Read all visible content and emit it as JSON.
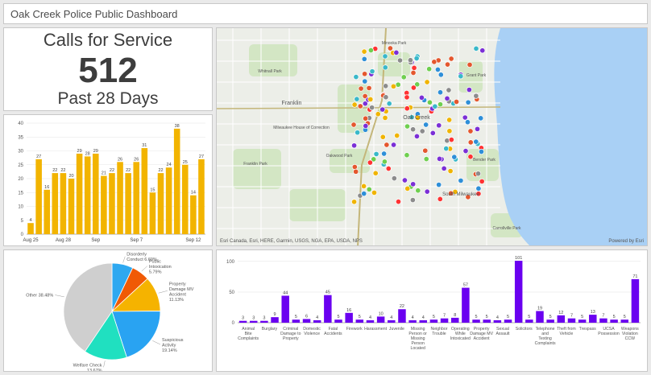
{
  "header": {
    "title": "Oak Creek Police Public Dashboard"
  },
  "kpi": {
    "title": "Calls for Service",
    "value": "512",
    "subtitle": "Past 28 Days"
  },
  "map": {
    "labels": [
      {
        "t": "Franklin",
        "x": 93,
        "y": 95,
        "s": 7
      },
      {
        "t": "Oak Creek",
        "x": 248,
        "y": 113,
        "s": 7
      },
      {
        "t": "South Milwaukee",
        "x": 303,
        "y": 208,
        "s": 6
      },
      {
        "t": "Minooka Park",
        "x": 220,
        "y": 20,
        "s": 5
      },
      {
        "t": "Grant Park",
        "x": 322,
        "y": 60,
        "s": 5
      },
      {
        "t": "Milwaukee House of Correction",
        "x": 105,
        "y": 125,
        "s": 5
      },
      {
        "t": "Franklin Park",
        "x": 48,
        "y": 170,
        "s": 5
      },
      {
        "t": "Oakwood Park",
        "x": 152,
        "y": 160,
        "s": 5
      },
      {
        "t": "Bender Park",
        "x": 332,
        "y": 165,
        "s": 5
      },
      {
        "t": "Carrollville Park",
        "x": 360,
        "y": 250,
        "s": 5
      },
      {
        "t": "Whitnall Park",
        "x": 66,
        "y": 55,
        "s": 5
      }
    ],
    "attribution": "Esri Canada, Esri, HERE, Garmin, USGS, NGA, EPA, USDA, NPS",
    "powered": "Powered by Esri",
    "colors": [
      "#7b2fd6",
      "#2e8fd8",
      "#39b8c9",
      "#e4572e",
      "#f0b400",
      "#6fcf4f",
      "#ff3333",
      "#8c8c8c"
    ]
  },
  "chart_data": [
    {
      "type": "bar",
      "title": "",
      "color": "#f2b400",
      "values": [
        4,
        27,
        16,
        22,
        22,
        20,
        29,
        28,
        29,
        21,
        22,
        26,
        22,
        26,
        31,
        15,
        22,
        24,
        38,
        25,
        14,
        27
      ],
      "x_tick_labels": [
        "Aug 25",
        "Aug 28",
        "Sep",
        "Sep 7",
        "Sep 12"
      ],
      "x_tick_index": [
        0,
        4,
        8,
        13,
        20
      ],
      "ylim": [
        0,
        40
      ],
      "y_ticks": [
        0,
        5,
        10,
        15,
        20,
        25,
        30,
        35,
        40
      ]
    },
    {
      "type": "pie",
      "slices": [
        {
          "label": "Disorderly Conduct 6.69%",
          "value": 6.69,
          "color": "#2ea8f0"
        },
        {
          "label": "Public Intoxication 5.79%",
          "value": 5.79,
          "color": "#f05a05"
        },
        {
          "label": "Property Damage MV Accident 11.13%",
          "value": 11.13,
          "color": "#f5b300"
        },
        {
          "label": "Suspicious Activity 19.14%",
          "value": 19.14,
          "color": "#29a3f2"
        },
        {
          "label": "Welfare Check 13.67%",
          "value": 13.67,
          "color": "#20e0c0"
        },
        {
          "label": "Other 38.48%",
          "value": 38.48,
          "color": "#cfcfcf"
        }
      ]
    },
    {
      "type": "bar",
      "title": "",
      "color": "#6a00f0",
      "values": [
        3,
        3,
        3,
        9,
        44,
        5,
        6,
        4,
        45,
        5,
        16,
        5,
        4,
        10,
        4,
        22,
        4,
        4,
        5,
        7,
        8,
        57,
        5,
        5,
        4,
        5,
        101,
        5,
        19,
        5,
        12,
        7,
        5,
        13,
        7,
        5,
        5,
        71
      ],
      "data_labels": [
        "3",
        "3",
        "3",
        "9",
        "44",
        "5",
        "6",
        "4",
        "45",
        "5",
        "16",
        "5",
        "4",
        "10",
        "4",
        "22",
        "4",
        "4",
        "5",
        "7",
        "8",
        "57",
        "5",
        "5",
        "4",
        "5",
        "101",
        "5",
        "19",
        "5",
        "12",
        "7",
        "5",
        "13",
        "7",
        "5",
        "5",
        "71"
      ],
      "ylim": [
        0,
        100
      ],
      "y_ticks": [
        0,
        50,
        100
      ],
      "categories": [
        {
          "label": "Animal Bite Complaints",
          "i": 1
        },
        {
          "label": "Burglary",
          "i": 3
        },
        {
          "label": "Criminal Damage to Property",
          "i": 5
        },
        {
          "label": "Domestic Violence",
          "i": 7
        },
        {
          "label": "Fatal Accidents",
          "i": 9
        },
        {
          "label": "Firework",
          "i": 11
        },
        {
          "label": "Harassment",
          "i": 13
        },
        {
          "label": "Juvenile",
          "i": 15
        },
        {
          "label": "Missing Person or Missing Person Located",
          "i": 17
        },
        {
          "label": "Neighbor Trouble",
          "i": 19
        },
        {
          "label": "Operating While Intoxicated",
          "i": 21
        },
        {
          "label": "Property Damage MV Accident",
          "i": 23
        },
        {
          "label": "Sexual Assault",
          "i": 25
        },
        {
          "label": "Solicitors",
          "i": 27
        },
        {
          "label": "Telephone and Texting Complaints",
          "i": 29
        },
        {
          "label": "Theft from Vehicle",
          "i": 31
        },
        {
          "label": "Trespass",
          "i": 33
        },
        {
          "label": "UCSA Possession",
          "i": 35
        },
        {
          "label": "Weapons Violation CCW",
          "i": 37
        }
      ]
    }
  ]
}
